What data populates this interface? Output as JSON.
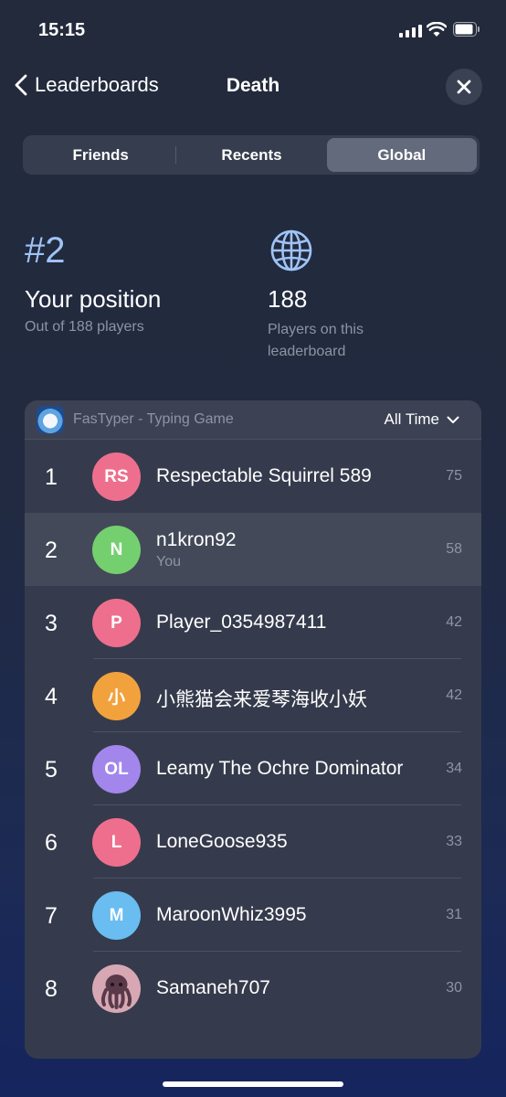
{
  "status_bar": {
    "time": "15:15"
  },
  "nav": {
    "back_label": "Leaderboards",
    "title": "Death"
  },
  "segments": [
    "Friends",
    "Recents",
    "Global"
  ],
  "active_segment": "Global",
  "stats": {
    "rank": "#2",
    "position_label": "Your position",
    "position_sub": "Out of 188 players",
    "count": "188",
    "count_sub": "Players on this leaderboard"
  },
  "board": {
    "app_name": "FasTyper - Typing Game",
    "filter": "All Time",
    "you_label": "You",
    "rows": [
      {
        "rank": "1",
        "initials": "RS",
        "name": "Respectable Squirrel 589",
        "score": "75",
        "color": "#ee6f8d"
      },
      {
        "rank": "2",
        "initials": "N",
        "name": "n1kron92",
        "score": "58",
        "color": "#74d06f",
        "me": true
      },
      {
        "rank": "3",
        "initials": "P",
        "name": "Player_0354987411",
        "score": "42",
        "color": "#ee6f8d"
      },
      {
        "rank": "4",
        "initials": "小",
        "name": "小熊猫会来爱琴海收小妖",
        "score": "42",
        "color": "#f2a23d"
      },
      {
        "rank": "5",
        "initials": "OL",
        "name": "Leamy The Ochre Dominator",
        "score": "34",
        "color": "#a286ec"
      },
      {
        "rank": "6",
        "initials": "L",
        "name": "LoneGoose935",
        "score": "33",
        "color": "#ee6f8d"
      },
      {
        "rank": "7",
        "initials": "M",
        "name": "MaroonWhiz3995",
        "score": "31",
        "color": "#69bdf0"
      },
      {
        "rank": "8",
        "initials": "",
        "name": "Samaneh707",
        "score": "30",
        "color": "#d7a8b4",
        "avatar_icon": "octopus-icon"
      }
    ]
  }
}
